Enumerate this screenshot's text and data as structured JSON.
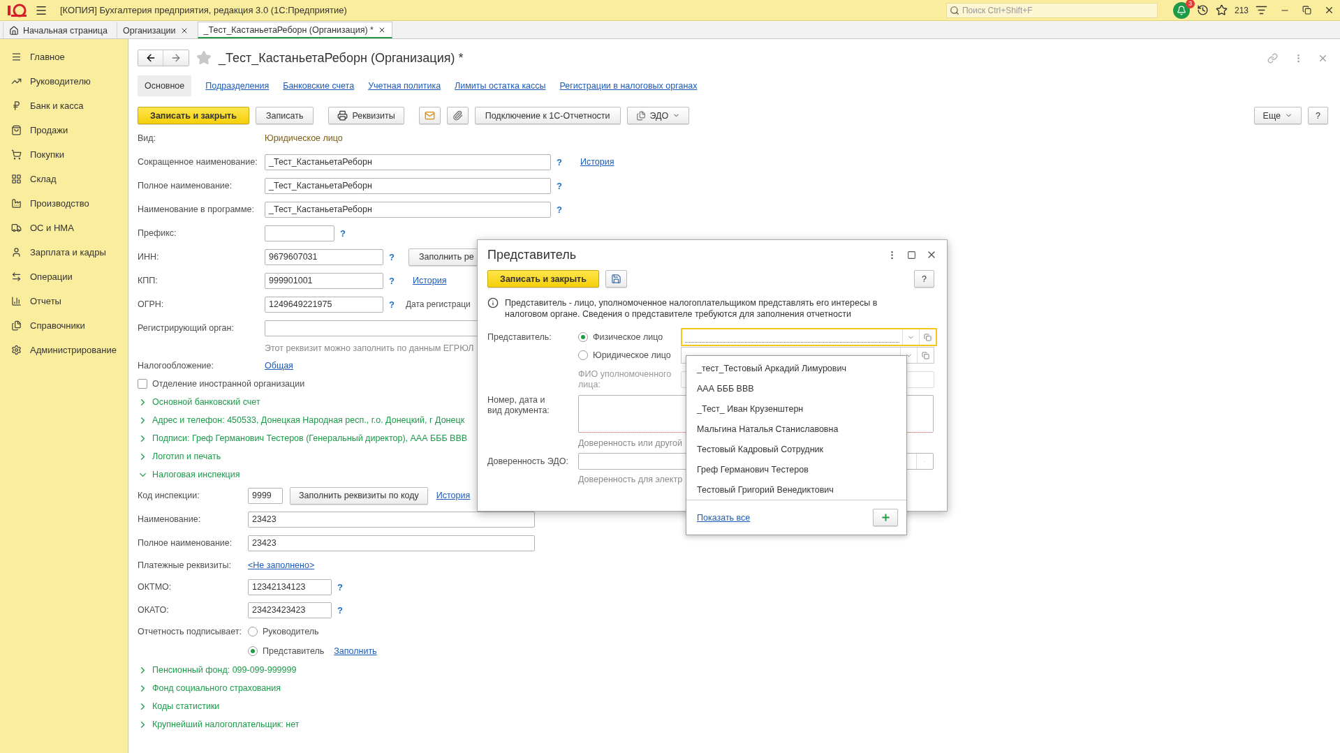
{
  "app": {
    "title": "[КОПИЯ] Бухгалтерия предприятия, редакция 3.0  (1С:Предприятие)",
    "search_placeholder": "Поиск Ctrl+Shift+F",
    "notifications": "3",
    "counter": "213"
  },
  "open_tabs": [
    {
      "label": "Начальная страница",
      "kind": "home",
      "selected": false
    },
    {
      "label": "Организации",
      "kind": "doc",
      "selected": false
    },
    {
      "label": "_Тест_КастаньетаРеборн (Организация) *",
      "kind": "doc",
      "selected": true
    }
  ],
  "sidebar": [
    {
      "label": "Главное"
    },
    {
      "label": "Руководителю"
    },
    {
      "label": "Банк и касса"
    },
    {
      "label": "Продажи"
    },
    {
      "label": "Покупки"
    },
    {
      "label": "Склад"
    },
    {
      "label": "Производство"
    },
    {
      "label": "ОС и НМА"
    },
    {
      "label": "Зарплата и кадры"
    },
    {
      "label": "Операции"
    },
    {
      "label": "Отчеты"
    },
    {
      "label": "Справочники"
    },
    {
      "label": "Администрирование"
    }
  ],
  "form": {
    "title": "_Тест_КастаньетаРеборн (Организация) *",
    "sections": [
      {
        "label": "Основное",
        "selected": true
      },
      {
        "label": "Подразделения",
        "selected": false
      },
      {
        "label": "Банковские счета",
        "selected": false
      },
      {
        "label": "Учетная политика",
        "selected": false
      },
      {
        "label": "Лимиты остатка кассы",
        "selected": false
      },
      {
        "label": "Регистрации в налоговых органах",
        "selected": false
      }
    ],
    "toolbar": [
      {
        "kind": "primary",
        "label": "Записать и закрыть"
      },
      {
        "kind": "plain",
        "label": "Записать"
      },
      {
        "kind": "print",
        "label": "Реквизиты"
      },
      {
        "kind": "mail"
      },
      {
        "kind": "attach"
      },
      {
        "kind": "plain",
        "label": "Подключение к 1С-Отчетности"
      },
      {
        "kind": "menu",
        "label": "ЭДО"
      }
    ],
    "more": "Еще",
    "help": "?",
    "content": [
      {
        "kind": "text_row",
        "label": "Вид:",
        "value": "Юридическое лицо"
      },
      {
        "kind": "input_row",
        "label": "Сокращенное наименование:",
        "value": "_Тест_КастаньетаРеборн",
        "help": "?",
        "link": "История"
      },
      {
        "kind": "input_row",
        "label": "Полное наименование:",
        "value": "_Тест_КастаньетаРеборн",
        "help": "?"
      },
      {
        "kind": "input_row",
        "label": "Наименование в программе:",
        "value": "_Тест_КастаньетаРеборн",
        "help": "?"
      },
      {
        "kind": "input_row",
        "label": "Префикс:",
        "help": "?"
      },
      {
        "kind": "input_row",
        "label": "ИНН:",
        "value": "9679607031",
        "help": "?",
        "button": "Заполнить ре"
      },
      {
        "kind": "input_row",
        "label": "КПП:",
        "value": "999901001",
        "help": "?",
        "link": "История"
      },
      {
        "kind": "input_row",
        "label": "ОГРН:",
        "value": "1249649221975",
        "help": "?",
        "note": "Дата регистраци"
      },
      {
        "kind": "input_row",
        "label": "Регистрирующий орган:"
      },
      {
        "kind": "hint",
        "text": "Этот реквизит можно заполнить по данным ЕГРЮЛ"
      },
      {
        "kind": "link_row",
        "label": "Налогообложение:",
        "value": "Общая"
      },
      {
        "kind": "checkbox",
        "label": "Отделение иностранной организации",
        "checked": false
      },
      {
        "kind": "group",
        "label": "Основной банковский счет",
        "expanded": false
      },
      {
        "kind": "group",
        "label": "Адрес и телефон: 450533, Донецкая Народная респ., г.о. Донецкий, г Донецк",
        "expanded": false
      },
      {
        "kind": "group",
        "label": "Подписи: Греф Германович Тестеров (Генеральный директор), ААА БББ ВВВ",
        "expanded": false
      },
      {
        "kind": "group",
        "label": "Логотип и печать",
        "expanded": false
      },
      {
        "kind": "group",
        "label": "Налоговая инспекция",
        "expanded": true,
        "children": [
          {
            "kind": "input_row",
            "label": "Код инспекции:",
            "value": "9999",
            "button": "Заполнить реквизиты по коду",
            "link": "История"
          },
          {
            "kind": "input_row",
            "label": "Наименование:",
            "value": "23423"
          },
          {
            "kind": "input_row",
            "label": "Полное наименование:",
            "value": "23423"
          },
          {
            "kind": "link_row",
            "label": "Платежные реквизиты:",
            "value": "<Не заполнено>"
          },
          {
            "kind": "input_row",
            "label": "ОКТМО:",
            "value": "12342134123",
            "help": "?"
          },
          {
            "kind": "input_row",
            "label": "ОКАТО:",
            "value": "23423423423",
            "help": "?"
          },
          {
            "kind": "radio_row",
            "label": "Отчетность подписывает:",
            "options": [
              {
                "label": "Руководитель",
                "selected": false
              },
              {
                "label": "Представитель",
                "selected": true,
                "link": "Заполнить"
              }
            ]
          }
        ]
      },
      {
        "kind": "group",
        "label": "Пенсионный фонд: 099-099-999999",
        "expanded": false
      },
      {
        "kind": "group",
        "label": "Фонд социального страхования",
        "expanded": false
      },
      {
        "kind": "group",
        "label": "Коды статистики",
        "expanded": false
      },
      {
        "kind": "group",
        "label": "Крупнейший налогоплательщик: нет",
        "expanded": false
      }
    ]
  },
  "dialog": {
    "title": "Представитель",
    "save_close": "Записать и закрыть",
    "help": "?",
    "info": "Представитель - лицо, уполномоченное налогоплательщиком представлять его интересы в налоговом органе. Сведения о представителе требуются для заполнения отчетности",
    "representative_label": "Представитель:",
    "types": [
      {
        "label": "Физическое лицо",
        "selected": true
      },
      {
        "label": "Юридическое лицо",
        "selected": false
      }
    ],
    "fio_label": "ФИО уполномоченного лица:",
    "doc_label": "Номер, дата и вид документа:",
    "doc_hint": "Доверенность или другой",
    "edo_label": "Доверенность ЭДО:",
    "edo_hint": "Доверенность для электр"
  },
  "dropdown": {
    "items": [
      "_тест_Тестовый Аркадий Лимурович",
      "ААА БББ ВВВ",
      "_Тест_ Иван Крузенштерн",
      "Мальгина Наталья Станиславовна",
      "Тестовый Кадровый Сотрудник",
      "Греф Германович Тестеров",
      "Тестовый Григорий Венедиктович"
    ],
    "show_all": "Показать все"
  }
}
